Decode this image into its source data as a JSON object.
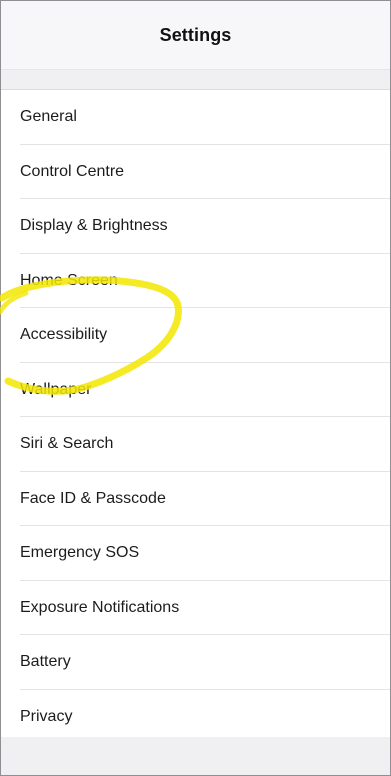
{
  "header": {
    "title": "Settings"
  },
  "settings_items": [
    {
      "label": "General"
    },
    {
      "label": "Control Centre"
    },
    {
      "label": "Display & Brightness"
    },
    {
      "label": "Home Screen"
    },
    {
      "label": "Accessibility"
    },
    {
      "label": "Wallpaper"
    },
    {
      "label": "Siri & Search"
    },
    {
      "label": "Face ID & Passcode"
    },
    {
      "label": "Emergency SOS"
    },
    {
      "label": "Exposure Notifications"
    },
    {
      "label": "Battery"
    },
    {
      "label": "Privacy"
    }
  ],
  "annotation": {
    "color": "#f2e600"
  }
}
